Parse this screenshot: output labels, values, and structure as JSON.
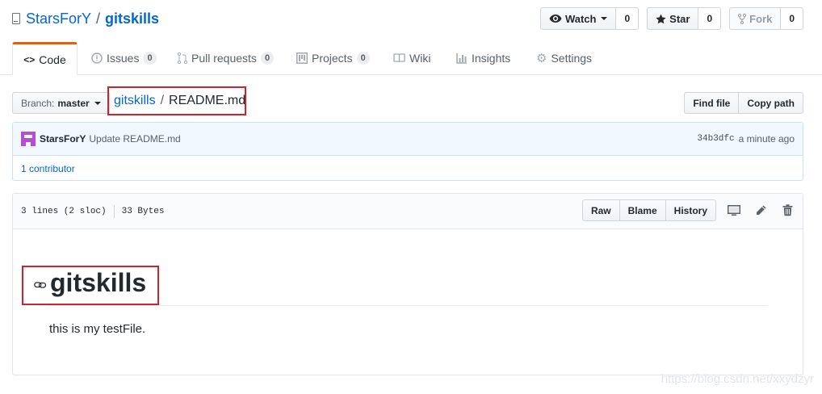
{
  "repo": {
    "owner": "StarsForY",
    "separator": "/",
    "name": "gitskills"
  },
  "actions": {
    "watch": {
      "label": "Watch",
      "count": "0"
    },
    "star": {
      "label": "Star",
      "count": "0"
    },
    "fork": {
      "label": "Fork",
      "count": "0"
    }
  },
  "tabs": [
    {
      "label": "Code"
    },
    {
      "label": "Issues",
      "count": "0"
    },
    {
      "label": "Pull requests",
      "count": "0"
    },
    {
      "label": "Projects",
      "count": "0"
    },
    {
      "label": "Wiki"
    },
    {
      "label": "Insights"
    },
    {
      "label": "Settings"
    }
  ],
  "branch": {
    "label": "Branch:",
    "value": "master"
  },
  "breadcrumb": {
    "repo": "gitskills",
    "separator": "/",
    "file": "README.md"
  },
  "file_nav": {
    "find_file": "Find file",
    "copy_path": "Copy path"
  },
  "commit": {
    "author": "StarsForY",
    "message": "Update README.md",
    "sha": "34b3dfc",
    "time": "a minute ago",
    "contributors": "1 contributor"
  },
  "file": {
    "lines": "3 lines (2 sloc)",
    "size": "33 Bytes",
    "raw": "Raw",
    "blame": "Blame",
    "history": "History"
  },
  "readme": {
    "heading": "gitskills",
    "paragraph": "this is my testFile."
  },
  "watermark": "https://blog.csdn.net/xxydzyr",
  "icons": {
    "repo": "repo-icon",
    "watch": "eye-icon",
    "star": "star-icon",
    "fork": "fork-icon",
    "code": "code-icon",
    "issues": "issue-icon",
    "pulls": "pull-request-icon",
    "projects": "project-icon",
    "wiki": "book-icon",
    "insights": "graph-icon",
    "settings": "gear-icon",
    "desktop": "desktop-icon",
    "edit": "pencil-icon",
    "delete": "trashcan-icon",
    "anchor": "link-icon"
  },
  "colors": {
    "link": "#0366d6",
    "tab_accent": "#e36209",
    "highlight_box": "#d0222d",
    "commit_bg": "#f1f8ff"
  }
}
